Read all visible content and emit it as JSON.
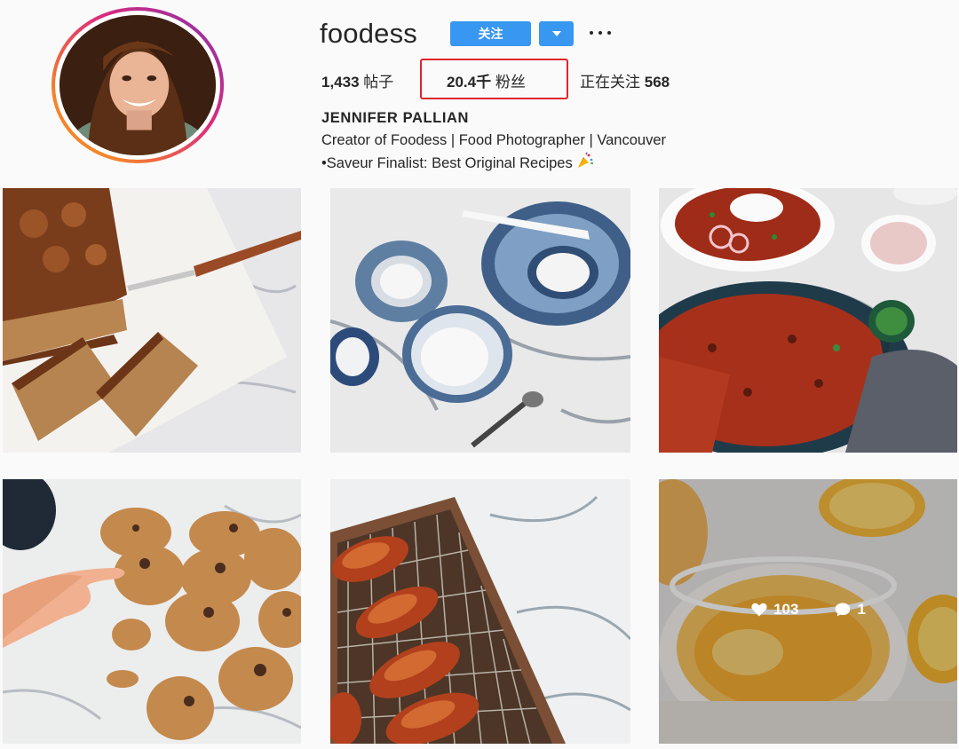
{
  "profile": {
    "username": "foodess",
    "follow_label": "关注",
    "stats": {
      "posts_count": "1,433",
      "posts_label": "帖子",
      "followers_count": "20.4千",
      "followers_label": "粉丝",
      "following_label": "正在关注",
      "following_count": "568"
    },
    "highlight_color": "#e0242b",
    "bio": {
      "name": "JENNIFER PALLIAN",
      "line1": "Creator of Foodess | Food Photographer | Vancouver",
      "line2": "•Saveur Finalist: Best Original Recipes"
    }
  },
  "colors": {
    "accent": "#3897f0",
    "ring_start": "#f58529",
    "ring_end": "#dd2a7b"
  },
  "posts": [
    {
      "subject": "banana-bread",
      "icon": "image-icon"
    },
    {
      "subject": "salt-bowls",
      "icon": "image-icon"
    },
    {
      "subject": "chili-pot",
      "icon": "image-icon"
    },
    {
      "subject": "cookies",
      "icon": "image-icon"
    },
    {
      "subject": "chicken-drumsticks",
      "icon": "image-icon"
    },
    {
      "subject": "citrus-drink",
      "icon": "image-icon",
      "likes": "103",
      "comments": "1"
    }
  ]
}
